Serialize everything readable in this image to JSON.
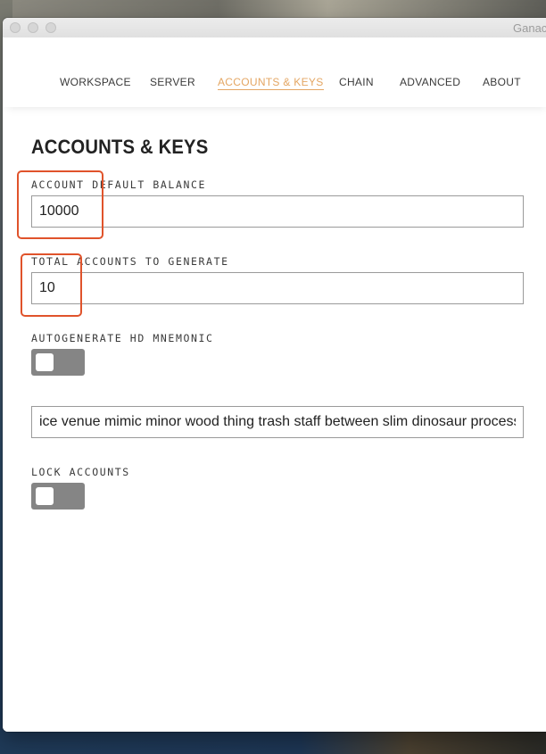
{
  "window": {
    "title": "Ganac"
  },
  "nav": {
    "items": [
      {
        "label": "WORKSPACE"
      },
      {
        "label": "SERVER"
      },
      {
        "label": "ACCOUNTS & KEYS",
        "active": true
      },
      {
        "label": "CHAIN"
      },
      {
        "label": "ADVANCED"
      },
      {
        "label": "ABOUT"
      }
    ]
  },
  "page": {
    "title": "ACCOUNTS & KEYS"
  },
  "fields": {
    "default_balance": {
      "label": "ACCOUNT DEFAULT BALANCE",
      "value": "10000"
    },
    "total_accounts": {
      "label": "TOTAL ACCOUNTS TO GENERATE",
      "value": "10"
    },
    "autogenerate_mnemonic": {
      "label": "AUTOGENERATE HD MNEMONIC",
      "enabled": false
    },
    "mnemonic": {
      "value": "ice venue mimic minor wood thing trash staff between slim dinosaur process"
    },
    "lock_accounts": {
      "label": "LOCK ACCOUNTS",
      "enabled": false
    }
  },
  "colors": {
    "accent": "#e4a663",
    "highlight": "#e0532b",
    "toggle_off": "#858585"
  }
}
